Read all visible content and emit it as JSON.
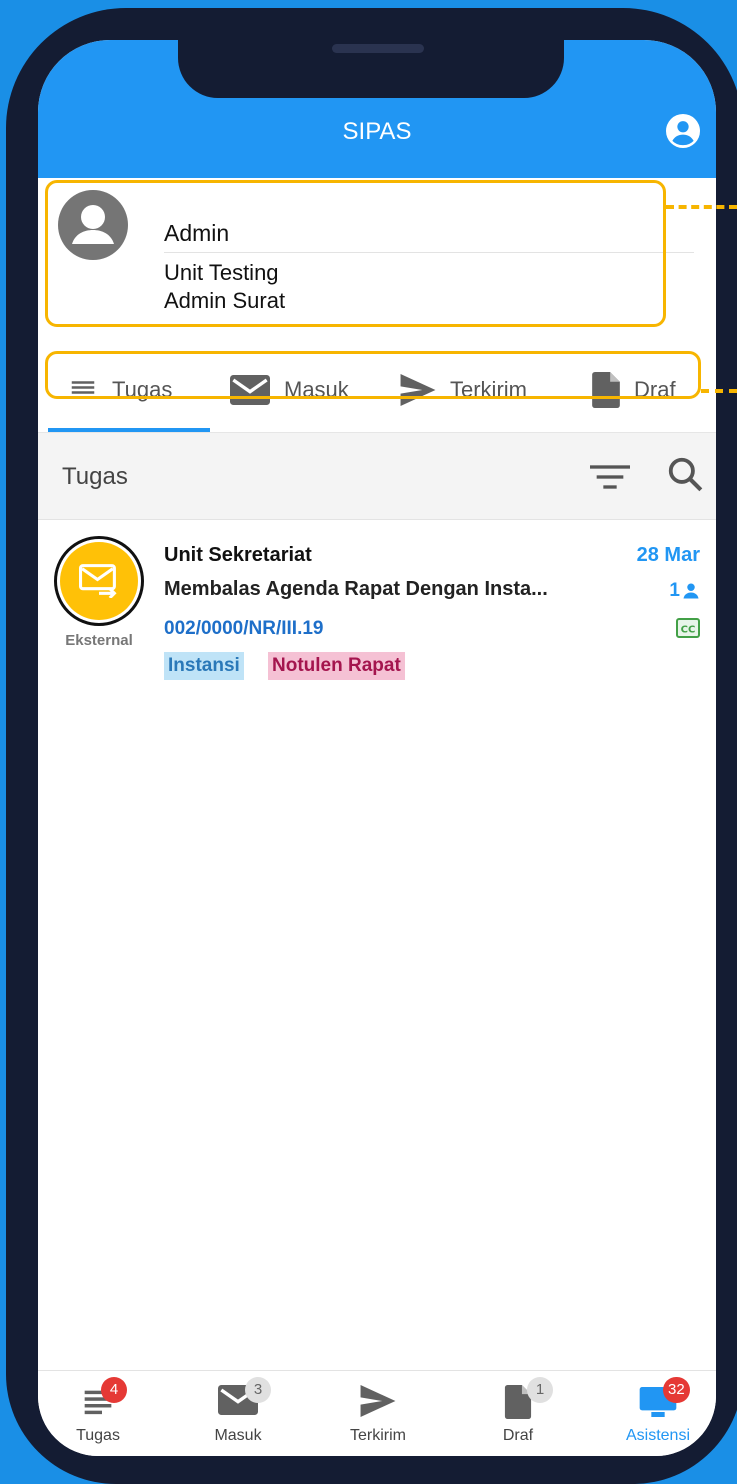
{
  "app": {
    "title": "SIPAS"
  },
  "profile": {
    "name": "Admin",
    "unit": "Unit Testing",
    "role": "Admin Surat"
  },
  "tabs": [
    {
      "label": "Tugas",
      "icon": "list-icon"
    },
    {
      "label": "Masuk",
      "icon": "mail-icon"
    },
    {
      "label": "Terkirim",
      "icon": "send-icon"
    },
    {
      "label": "Draf",
      "icon": "document-icon"
    }
  ],
  "section": {
    "title": "Tugas"
  },
  "list": [
    {
      "type": "Eksternal",
      "sender": "Unit Sekretariat",
      "subject": "Membalas Agenda Rapat Dengan Insta...",
      "number": "002/0000/NR/III.19",
      "date": "28 Mar",
      "recipients": "1",
      "cc": "CC",
      "tags": [
        "Instansi",
        "Notulen Rapat"
      ]
    }
  ],
  "bottom_nav": [
    {
      "label": "Tugas",
      "badge": "4",
      "icon": "list-icon"
    },
    {
      "label": "Masuk",
      "badge": "3",
      "icon": "mail-icon"
    },
    {
      "label": "Terkirim",
      "badge": "",
      "icon": "send-icon"
    },
    {
      "label": "Draf",
      "badge": "1",
      "icon": "document-icon"
    },
    {
      "label": "Asistensi",
      "badge": "32",
      "icon": "monitor-icon"
    }
  ],
  "colors": {
    "primary": "#2196f3",
    "highlight": "#f7b500",
    "badge_red": "#e53935"
  }
}
